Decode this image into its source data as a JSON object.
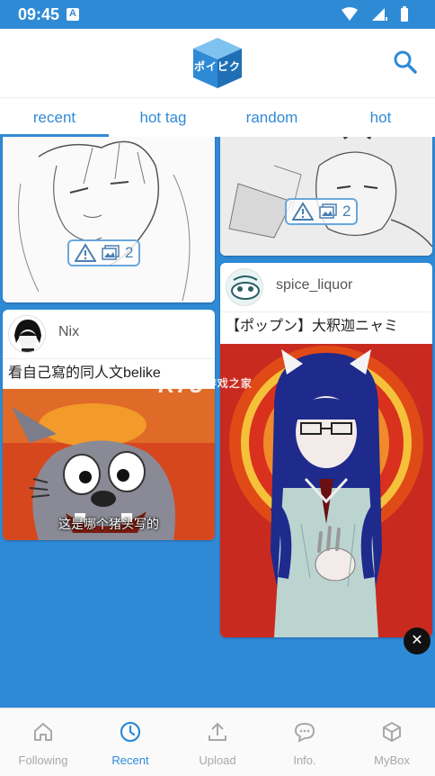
{
  "status_bar": {
    "time": "09:45"
  },
  "app": {
    "logo_text": "ポイピク"
  },
  "tabs": [
    {
      "label": "recent",
      "active": true
    },
    {
      "label": "hot tag",
      "active": false
    },
    {
      "label": "random",
      "active": false
    },
    {
      "label": "hot",
      "active": false
    }
  ],
  "feed": {
    "left_top_card": {
      "warning_icon": "warning-icon",
      "image_icon": "gallery-icon",
      "image_count": "2"
    },
    "right_top_card": {
      "warning_icon": "warning-icon",
      "image_icon": "gallery-icon",
      "image_count": "2"
    },
    "nix_card": {
      "username": "Nix",
      "caption": "看自己寫的同人文belike",
      "subtitle": "这是哪个猪头写的"
    },
    "spice_card": {
      "username": "spice_liquor",
      "caption": "【ポップン】大釈迦ニャミ"
    }
  },
  "watermark": {
    "main": "K73",
    "sub": "游戏之家"
  },
  "bottom_nav": [
    {
      "label": "Following",
      "icon": "home-icon",
      "active": false
    },
    {
      "label": "Recent",
      "icon": "clock-icon",
      "active": true
    },
    {
      "label": "Upload",
      "icon": "upload-icon",
      "active": false
    },
    {
      "label": "Info.",
      "icon": "chat-icon",
      "active": false
    },
    {
      "label": "MyBox",
      "icon": "box-icon",
      "active": false
    }
  ],
  "colors": {
    "accent": "#2f8ad6",
    "inactive": "#a8a8a8"
  }
}
